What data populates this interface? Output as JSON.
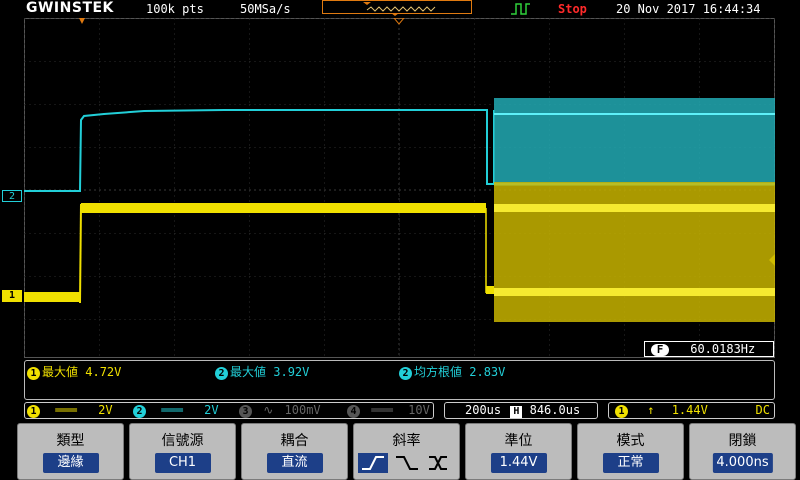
{
  "topbar": {
    "brand": "GWINSTEK",
    "record_length": "100k pts",
    "sample_rate": "50MSa/s",
    "run_state": "Stop",
    "datetime": "20 Nov 2017 16:44:34"
  },
  "channel_markers": {
    "ch2": "2",
    "ch1": "1"
  },
  "frequency": {
    "icon": "F",
    "value": "60.0183Hz"
  },
  "measurements": [
    {
      "ch": "1",
      "label": "最大値",
      "value": "4.72V"
    },
    {
      "ch": "2",
      "label": "最大値",
      "value": "3.92V"
    },
    {
      "ch": "2",
      "label": "均方根値",
      "value": "2.83V"
    }
  ],
  "status": {
    "ch1": {
      "num": "1",
      "scale": "2V"
    },
    "ch2": {
      "num": "2",
      "scale": "2V"
    },
    "ch3": {
      "num": "3",
      "scale": "100mV"
    },
    "ch4": {
      "num": "4",
      "scale": "10V"
    },
    "timebase": "200us",
    "h_icon": "H",
    "position": "846.0us",
    "trig_ch": "1",
    "trig_level": "1.44V",
    "coupling": "DC"
  },
  "menu": [
    {
      "label": "類型",
      "value": "邊緣"
    },
    {
      "label": "信號源",
      "value": "CH1"
    },
    {
      "label": "耦合",
      "value": "直流"
    },
    {
      "label": "斜率",
      "value": ""
    },
    {
      "label": "準位",
      "value": "1.44V"
    },
    {
      "label": "模式",
      "value": "正常"
    },
    {
      "label": "閉鎖",
      "value": "4.000ns"
    }
  ],
  "colors": {
    "ch1": "#f0e000",
    "ch2": "#22cfd8",
    "accent": "#e07a10",
    "stop": "#ff2a2a",
    "menu_value_bg": "#1d3f88"
  }
}
